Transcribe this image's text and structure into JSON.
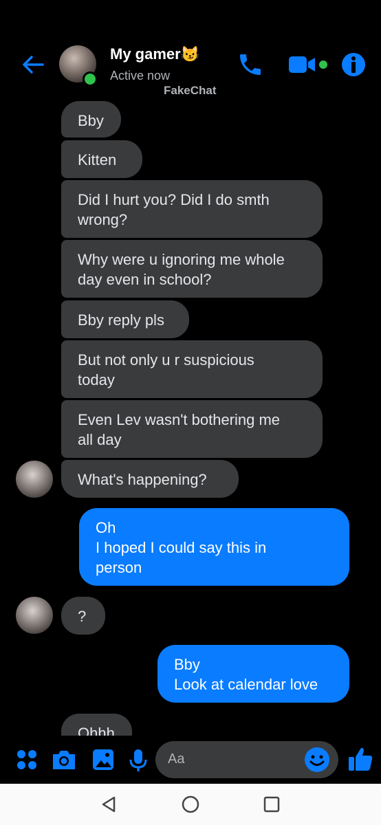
{
  "header": {
    "contact_name": "My gamer😼",
    "status": "Active now",
    "watermark": "FakeChat",
    "icons": [
      "back-arrow-icon",
      "phone-icon",
      "video-camera-icon",
      "info-icon"
    ]
  },
  "messages": [
    {
      "dir": "in",
      "text": "Bby"
    },
    {
      "dir": "in",
      "text": "Kitten"
    },
    {
      "dir": "in",
      "text": "Did I hurt you? Did I do smth\nwrong?"
    },
    {
      "dir": "in",
      "text": "Why were u ignoring me whole\nday even in school?"
    },
    {
      "dir": "in",
      "text": "Bby reply pls"
    },
    {
      "dir": "in",
      "text": "But not only u r suspicious\ntoday"
    },
    {
      "dir": "in",
      "text": "Even Lev wasn't bothering me\nall day"
    },
    {
      "dir": "in",
      "text": "What's happening?"
    },
    {
      "dir": "out",
      "text": "Oh\nI hoped I could say this in\nperson"
    },
    {
      "dir": "in",
      "text": "?"
    },
    {
      "dir": "out",
      "text": "Bby\nLook at calendar love"
    },
    {
      "dir": "in",
      "text": "Ohhh"
    }
  ],
  "composer": {
    "placeholder": "Aa",
    "icons": [
      "apps-icon",
      "camera-icon",
      "gallery-icon",
      "microphone-icon",
      "emoji-icon",
      "thumbs-up-icon"
    ]
  },
  "colors": {
    "accent": "#0a7cff",
    "incoming_bubble": "#3a3b3c",
    "online": "#31c24d"
  }
}
